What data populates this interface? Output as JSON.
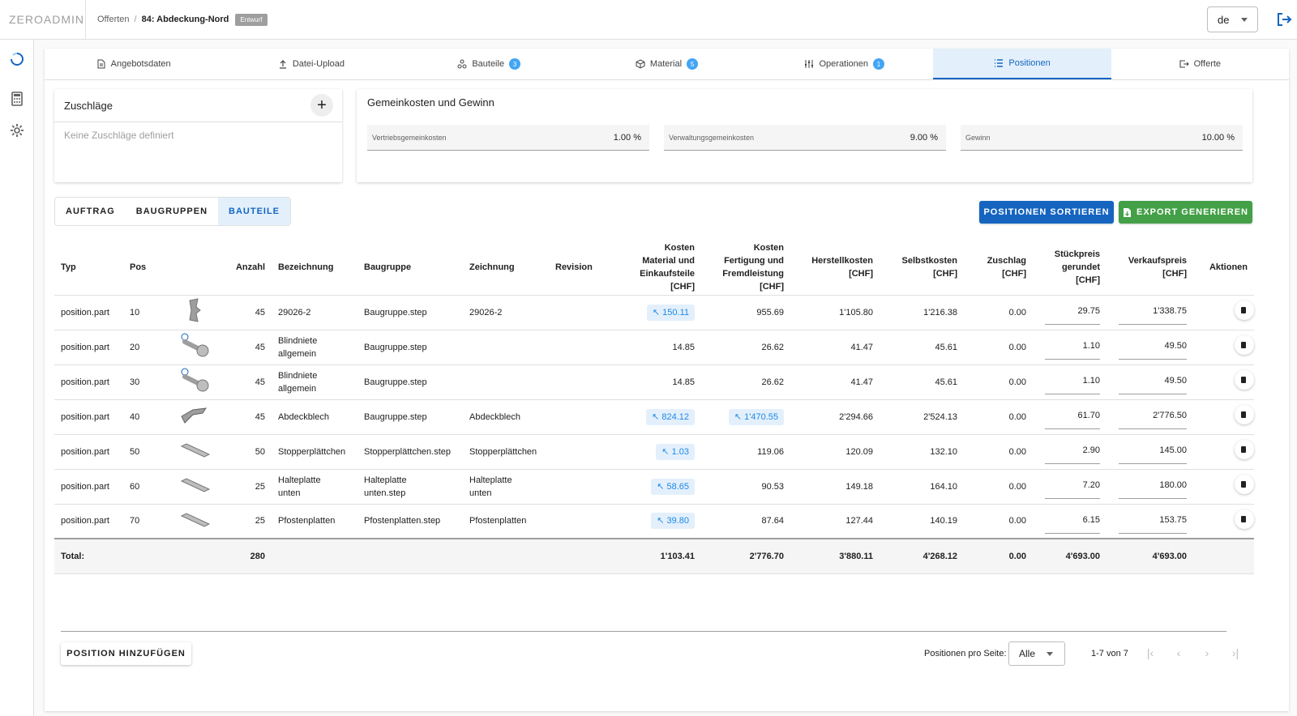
{
  "app": {
    "logo": "ZEROADMIN"
  },
  "breadcrumb": {
    "parent": "Offerten",
    "separator": "/",
    "current": "84: Abdeckung-Nord",
    "status": "Entwurf"
  },
  "header": {
    "language": "de"
  },
  "tabs": [
    {
      "label": "Angebotsdaten",
      "icon": "document-icon",
      "count": ""
    },
    {
      "label": "Datei-Upload",
      "icon": "upload-icon",
      "count": ""
    },
    {
      "label": "Bauteile",
      "icon": "parts-icon",
      "count": "3"
    },
    {
      "label": "Material",
      "icon": "cube-icon",
      "count": "5"
    },
    {
      "label": "Operationen",
      "icon": "sliders-icon",
      "count": "1"
    },
    {
      "label": "Positionen",
      "icon": "list-icon",
      "count": "",
      "active": true
    },
    {
      "label": "Offerte",
      "icon": "export-icon",
      "count": ""
    }
  ],
  "surcharges": {
    "title": "Zuschläge",
    "empty_text": "Keine Zuschläge definiert"
  },
  "overhead": {
    "title": "Gemeinkosten und Gewinn",
    "fields": [
      {
        "label": "Vertriebsgemeinkosten",
        "value": "1.00 %"
      },
      {
        "label": "Verwaltungsgemeinkosten",
        "value": "9.00 %"
      },
      {
        "label": "Gewinn",
        "value": "10.00 %"
      }
    ]
  },
  "view_toggle": {
    "options": [
      "AUFTRAG",
      "BAUGRUPPEN",
      "BAUTEILE"
    ],
    "selected": "BAUTEILE"
  },
  "actions": {
    "sort_label": "POSITIONEN SORTIEREN",
    "export_label": "EXPORT GENERIEREN"
  },
  "table": {
    "headers": {
      "typ": "Typ",
      "pos": "Pos",
      "anzahl": "Anzahl",
      "bezeichnung": "Bezeichnung",
      "baugruppe": "Baugruppe",
      "zeichnung": "Zeichnung",
      "revision": "Revision",
      "kosten_material_l1": "Kosten",
      "kosten_material_l2": "Material und",
      "kosten_material_l3": "Einkaufsteile",
      "kosten_material_l4": "[CHF]",
      "kosten_fertigung_l1": "Kosten",
      "kosten_fertigung_l2": "Fertigung und",
      "kosten_fertigung_l3": "Fremdleistung",
      "kosten_fertigung_l4": "[CHF]",
      "herstell_l1": "Herstellkosten",
      "herstell_l2": "[CHF]",
      "selbst_l1": "Selbstkosten",
      "selbst_l2": "[CHF]",
      "zuschlag_l1": "Zuschlag",
      "zuschlag_l2": "[CHF]",
      "stueck_l1": "Stückpreis",
      "stueck_l2": "gerundet",
      "stueck_l3": "[CHF]",
      "verkauf_l1": "Verkaufspreis",
      "verkauf_l2": "[CHF]",
      "aktionen": "Aktionen"
    },
    "rows": [
      {
        "typ": "position.part",
        "pos": "10",
        "thumb": "bracket-part-icon",
        "anzahl": "45",
        "bez1": "29026-2",
        "bez2": "",
        "bg1": "Baugruppe.step",
        "bg2": "",
        "z1": "29026-2",
        "z2": "",
        "revision": "",
        "material": "150.11",
        "material_linked": true,
        "fertigung": "955.69",
        "fertigung_linked": false,
        "herstell": "1'105.80",
        "selbst": "1'216.38",
        "zuschlag": "0.00",
        "stueck": "29.75",
        "verkauf": "1'338.75"
      },
      {
        "typ": "position.part",
        "pos": "20",
        "thumb": "rivet-icon",
        "anzahl": "45",
        "bez1": "Blindniete",
        "bez2": "allgemein",
        "bg1": "Baugruppe.step",
        "bg2": "",
        "z1": "",
        "z2": "",
        "revision": "",
        "material": "14.85",
        "material_linked": false,
        "fertigung": "26.62",
        "fertigung_linked": false,
        "herstell": "41.47",
        "selbst": "45.61",
        "zuschlag": "0.00",
        "stueck": "1.10",
        "verkauf": "49.50"
      },
      {
        "typ": "position.part",
        "pos": "30",
        "thumb": "rivet-icon",
        "anzahl": "45",
        "bez1": "Blindniete",
        "bez2": "allgemein",
        "bg1": "Baugruppe.step",
        "bg2": "",
        "z1": "",
        "z2": "",
        "revision": "",
        "material": "14.85",
        "material_linked": false,
        "fertigung": "26.62",
        "fertigung_linked": false,
        "herstell": "41.47",
        "selbst": "45.61",
        "zuschlag": "0.00",
        "stueck": "1.10",
        "verkauf": "49.50"
      },
      {
        "typ": "position.part",
        "pos": "40",
        "thumb": "sheet-part-icon",
        "anzahl": "45",
        "bez1": "Abdeckblech",
        "bez2": "",
        "bg1": "Baugruppe.step",
        "bg2": "",
        "z1": "Abdeckblech",
        "z2": "",
        "revision": "",
        "material": "824.12",
        "material_linked": true,
        "fertigung": "1'470.55",
        "fertigung_linked": true,
        "herstell": "2'294.66",
        "selbst": "2'524.13",
        "zuschlag": "0.00",
        "stueck": "61.70",
        "verkauf": "2'776.50"
      },
      {
        "typ": "position.part",
        "pos": "50",
        "thumb": "plate-icon",
        "anzahl": "50",
        "bez1": "Stopperplättchen",
        "bez2": "",
        "bg1": "Stopperplättchen.step",
        "bg2": "",
        "z1": "Stopperplättchen",
        "z2": "",
        "revision": "",
        "material": "1.03",
        "material_linked": true,
        "fertigung": "119.06",
        "fertigung_linked": false,
        "herstell": "120.09",
        "selbst": "132.10",
        "zuschlag": "0.00",
        "stueck": "2.90",
        "verkauf": "145.00"
      },
      {
        "typ": "position.part",
        "pos": "60",
        "thumb": "plate-icon",
        "anzahl": "25",
        "bez1": "Halteplatte",
        "bez2": "unten",
        "bg1": "Halteplatte",
        "bg2": "unten.step",
        "z1": "Halteplatte",
        "z2": "unten",
        "revision": "",
        "material": "58.65",
        "material_linked": true,
        "fertigung": "90.53",
        "fertigung_linked": false,
        "herstell": "149.18",
        "selbst": "164.10",
        "zuschlag": "0.00",
        "stueck": "7.20",
        "verkauf": "180.00"
      },
      {
        "typ": "position.part",
        "pos": "70",
        "thumb": "plate-icon",
        "anzahl": "25",
        "bez1": "Pfostenplatten",
        "bez2": "",
        "bg1": "Pfostenplatten.step",
        "bg2": "",
        "z1": "Pfostenplatten",
        "z2": "",
        "revision": "",
        "material": "39.80",
        "material_linked": true,
        "fertigung": "87.64",
        "fertigung_linked": false,
        "herstell": "127.44",
        "selbst": "140.19",
        "zuschlag": "0.00",
        "stueck": "6.15",
        "verkauf": "153.75"
      }
    ],
    "total": {
      "label": "Total:",
      "anzahl": "280",
      "material": "1'103.41",
      "fertigung": "2'776.70",
      "herstell": "3'880.11",
      "selbst": "4'268.12",
      "zuschlag": "0.00",
      "stueck": "4'693.00",
      "verkauf": "4'693.00"
    }
  },
  "footer": {
    "add_label": "POSITION HINZUFÜGEN",
    "per_page_label": "Positionen pro Seite:",
    "per_page_value": "Alle",
    "range": "1-7 von 7"
  },
  "colors": {
    "primary": "#1565c0",
    "success": "#43a047",
    "chip_bg": "#e3f0fc",
    "chip_text": "#1e88e5"
  }
}
